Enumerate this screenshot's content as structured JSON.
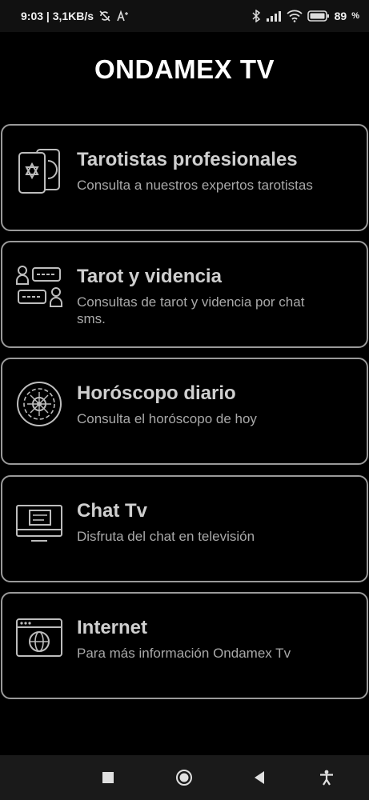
{
  "status_bar": {
    "time_net": "9:03 | 3,1KB/s",
    "battery": "89"
  },
  "app": {
    "title": "ONDAMEX TV"
  },
  "menu": [
    {
      "title": "Tarotistas profesionales",
      "subtitle": "Consulta a nuestros expertos tarotistas",
      "icon": "tarot-cards-icon"
    },
    {
      "title": "Tarot y videncia",
      "subtitle": "Consultas de tarot y videncia por chat sms.",
      "icon": "chat-people-icon"
    },
    {
      "title": "Horóscopo diario",
      "subtitle": "Consulta el horóscopo de hoy",
      "icon": "zodiac-wheel-icon"
    },
    {
      "title": "Chat Tv",
      "subtitle": "Disfruta del chat en televisión",
      "icon": "tv-chat-icon"
    },
    {
      "title": "Internet",
      "subtitle": "Para más información Ondamex Tv",
      "icon": "globe-browser-icon"
    }
  ],
  "colors": {
    "background": "#000000",
    "card_border": "#9a9a9a",
    "title_text": "#cfcfcf",
    "subtitle_text": "#a9a9a9"
  }
}
